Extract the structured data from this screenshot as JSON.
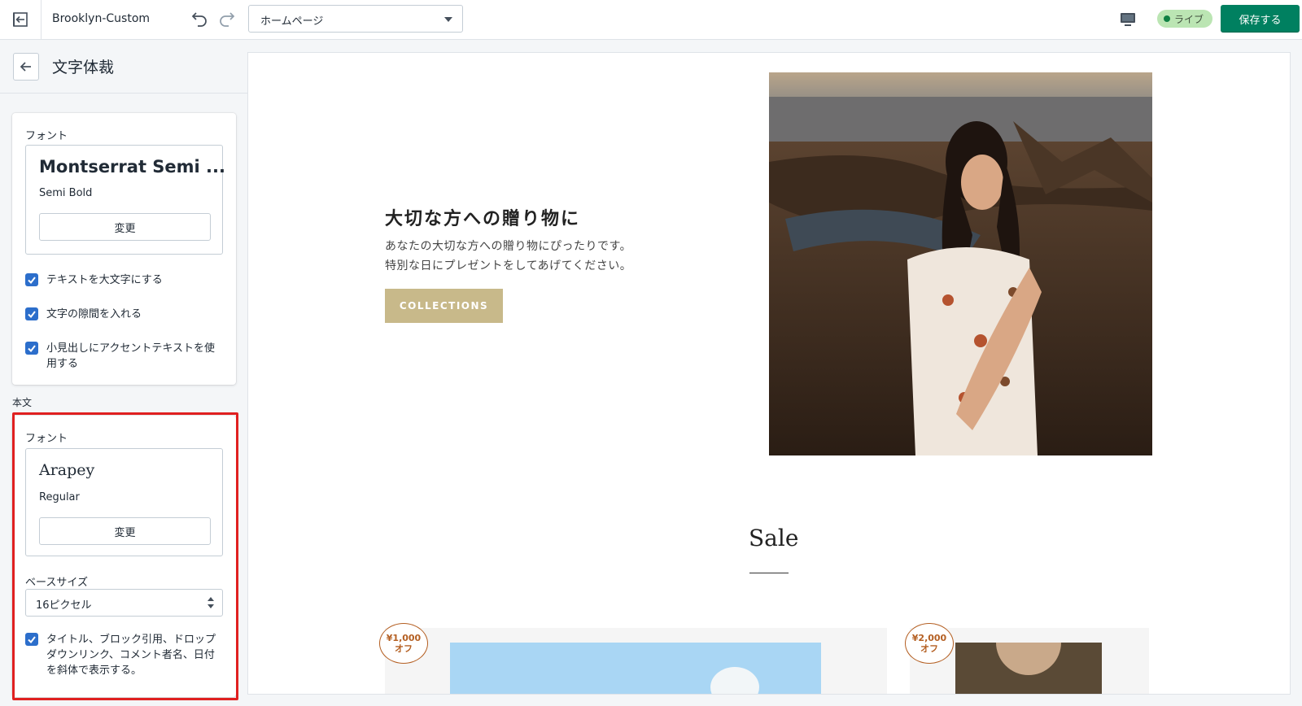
{
  "topbar": {
    "theme_name": "Brooklyn-Custom",
    "page_select": "ホームページ",
    "live_label": "ライブ",
    "save_label": "保存する"
  },
  "sidebar": {
    "title": "文字体裁",
    "heading_card": {
      "font_label": "フォント",
      "font_name": "Montserrat Semi ...",
      "font_style": "Semi Bold",
      "change_label": "変更",
      "checkboxes": [
        {
          "label": "テキストを大文字にする",
          "checked": true
        },
        {
          "label": "文字の隙間を入れる",
          "checked": true
        },
        {
          "label": "小見出しにアクセントテキストを使用する",
          "checked": true
        }
      ]
    },
    "body_section_label": "本文",
    "body_card": {
      "font_label": "フォント",
      "font_name": "Arapey",
      "font_style": "Regular",
      "change_label": "変更",
      "base_size_label": "ベースサイズ",
      "base_size_value": "16ピクセル",
      "italic_checkbox": {
        "label": "タイトル、ブロック引用、ドロップダウンリンク、コメント者名、日付を斜体で表示する。",
        "checked": true
      }
    }
  },
  "preview": {
    "hero_title": "大切な方への贈り物に",
    "hero_sub_1": "あなたの大切な方への贈り物にぴったりです。",
    "hero_sub_2": "特別な日にプレゼントをしてあげてください。",
    "hero_button": "COLLECTIONS",
    "sale_title": "Sale",
    "badges": [
      {
        "price": "¥1,000",
        "suffix": "オフ"
      },
      {
        "price": "¥2,000",
        "suffix": "オフ"
      }
    ]
  },
  "colors": {
    "primary_green": "#008060",
    "checkbox_blue": "#2c6ecb",
    "accent_button": "#c8b98a",
    "highlight_red": "#e02020",
    "badge_brown": "#b45f22"
  }
}
